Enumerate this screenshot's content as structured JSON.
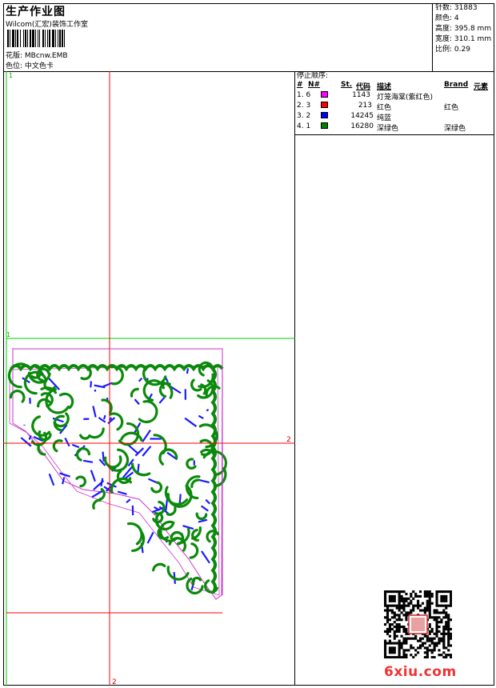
{
  "header": {
    "title": "生产作业图",
    "company": "Wilcom(汇宏)装饰工作室",
    "design_label": "花版:",
    "design_value": "MBcnw.EMB",
    "chart_label": "色位:",
    "chart_value": "中文色卡"
  },
  "stats": [
    {
      "label": "针数:",
      "value": "31883"
    },
    {
      "label": "颜色:",
      "value": "4"
    },
    {
      "label": "高度:",
      "value": "395.8 mm"
    },
    {
      "label": "宽度:",
      "value": "310.1 mm"
    },
    {
      "label": "比例:",
      "value": "0.29"
    }
  ],
  "stop_panel": {
    "title": "停止顺序:",
    "headers": {
      "num": "#",
      "n": "N#",
      "st": "St.",
      "code": "代码",
      "desc": "描述",
      "brand": "Brand",
      "element": "元素"
    },
    "rows": [
      {
        "num": "1. 6",
        "color": "#ff00ff",
        "code": "1143",
        "desc": "灯笼海棠(紫红色)",
        "brand": ""
      },
      {
        "num": "2. 3",
        "color": "#ff0000",
        "code": "213",
        "desc": "红色",
        "brand": "红色"
      },
      {
        "num": "3. 2",
        "color": "#0000ff",
        "code": "14245",
        "desc": "纯蓝",
        "brand": ""
      },
      {
        "num": "4. 1",
        "color": "#008000",
        "code": "16280",
        "desc": "深绿色",
        "brand": "深绿色"
      }
    ]
  },
  "canvas": {
    "marker_1_top": "1",
    "marker_1_mid": "1",
    "marker_2_right": "2",
    "marker_2_bottom": "2"
  },
  "watermark": "6xiu.com",
  "colors": {
    "guide_red": "#ff0000",
    "guide_green": "#00cc00",
    "outline": "#cc33cc",
    "stitch_green": "#0a8a0a",
    "stitch_blue": "#1a1aff"
  }
}
